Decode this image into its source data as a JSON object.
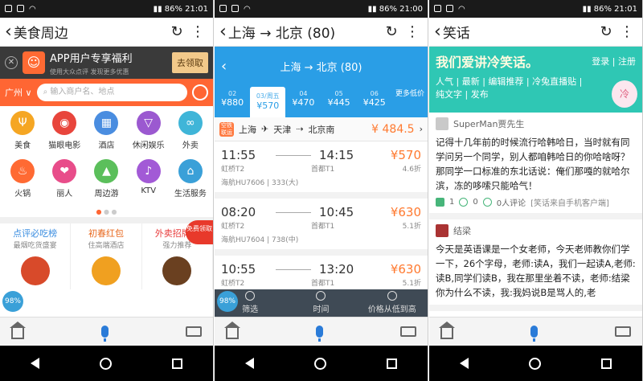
{
  "status": {
    "battery": "86%",
    "p1_time": "21:01",
    "p2_time": "21:00",
    "p3_time": "21:01"
  },
  "p1": {
    "title": "美食周边",
    "promo": {
      "title": "APP用户专享福利",
      "sub": "使用大众点评 发现更多优惠",
      "btn": "去领取"
    },
    "city": "广州",
    "search_placeholder": "输入商户名、地点",
    "cats": [
      {
        "label": "美食",
        "color": "#f5a623",
        "glyph": "Ψ"
      },
      {
        "label": "猫眼电影",
        "color": "#e8453c",
        "glyph": "◉"
      },
      {
        "label": "酒店",
        "color": "#4a8de0",
        "glyph": "▦"
      },
      {
        "label": "休闲娱乐",
        "color": "#9b59d0",
        "glyph": "▽"
      },
      {
        "label": "外卖",
        "color": "#3fb5d8",
        "glyph": "∞"
      },
      {
        "label": "火锅",
        "color": "#ff6a33",
        "glyph": "♨"
      },
      {
        "label": "丽人",
        "color": "#e84d8a",
        "glyph": "❤"
      },
      {
        "label": "周边游",
        "color": "#5bbf5b",
        "glyph": "▲"
      },
      {
        "label": "KTV",
        "color": "#a25ad6",
        "glyph": "♪"
      },
      {
        "label": "生活服务",
        "color": "#3aa0d8",
        "glyph": "⌂"
      }
    ],
    "recs": [
      {
        "title": "点评必吃榜",
        "sub": "最烟吃货盛宴",
        "color": "#3a8de0",
        "img": "#d84a2a"
      },
      {
        "title": "初春红包",
        "sub": "住高端酒店",
        "color": "#e86a20",
        "img": "#f0a020"
      },
      {
        "title": "外卖招牌菜",
        "sub": "强力推荐",
        "color": "#e83a3a",
        "img": "#6a4020"
      }
    ],
    "mianfei": "免费领取",
    "pct": "98%"
  },
  "p2": {
    "title": "上海 → 北京 (80)",
    "header": "上海 → 北京 (80)",
    "dates": [
      {
        "d": "02",
        "p": "¥880"
      },
      {
        "d": "03/周五",
        "p": "¥570",
        "sel": true
      },
      {
        "d": "04",
        "p": "¥470"
      },
      {
        "d": "05",
        "p": "¥445"
      },
      {
        "d": "06",
        "p": "¥425"
      }
    ],
    "more": "更多低价",
    "transfer": {
      "tag": "空铁联运",
      "from": "上海",
      "via": "天津",
      "to": "北京南",
      "price": "¥ 484.5"
    },
    "flights": [
      {
        "dep": "11:55",
        "arr": "14:15",
        "dep_ap": "虹桥T2",
        "arr_ap": "首都T1",
        "price": "570",
        "disc": "4.6折",
        "air": "海航HU7606 | 333(大)"
      },
      {
        "dep": "08:20",
        "arr": "10:45",
        "dep_ap": "虹桥T2",
        "arr_ap": "首都T1",
        "price": "630",
        "disc": "5.1折",
        "air": "海航HU7604 | 738(中)"
      },
      {
        "dep": "10:55",
        "arr": "13:20",
        "dep_ap": "虹桥T2",
        "arr_ap": "首都T1",
        "price": "630",
        "disc": "5.1折",
        "air": ""
      }
    ],
    "tabs": [
      "筛选",
      "时间",
      "价格从低到高"
    ],
    "pct": "98%"
  },
  "p3": {
    "title": "笑话",
    "logo": "我们爱讲冷笑话。",
    "login": "登录 | 注册",
    "menu1": "人气 | 最新 | 编辑推荐 | 冷兔直播贴 |",
    "menu2": "纯文字 | 发布",
    "mascot": "冷",
    "posts": [
      {
        "author": "SuperMan贾先生",
        "content": "记得十几年前的时候流行哈韩哈日，当时就有同学问另一个同学，别人都咱韩哈日的你哈啥呀？那同学一口标准的东北话说：俺们那嘎的就哈尔滨，冻的哆嗦只能哈气！",
        "likes": "1",
        "comments": "0",
        "reviews": "0人评论",
        "source": "[笑话来自手机客户端]"
      },
      {
        "author": "结梁",
        "content": "今天是英语课是一个女老师，今天老师教你们学一下，26个字母，老师:读A，我们一起读A,老师:读B,同学们读B，我在那里坐着不读，老师:结梁你为什么不读，我:我妈说B是骂人的,老"
      }
    ]
  }
}
